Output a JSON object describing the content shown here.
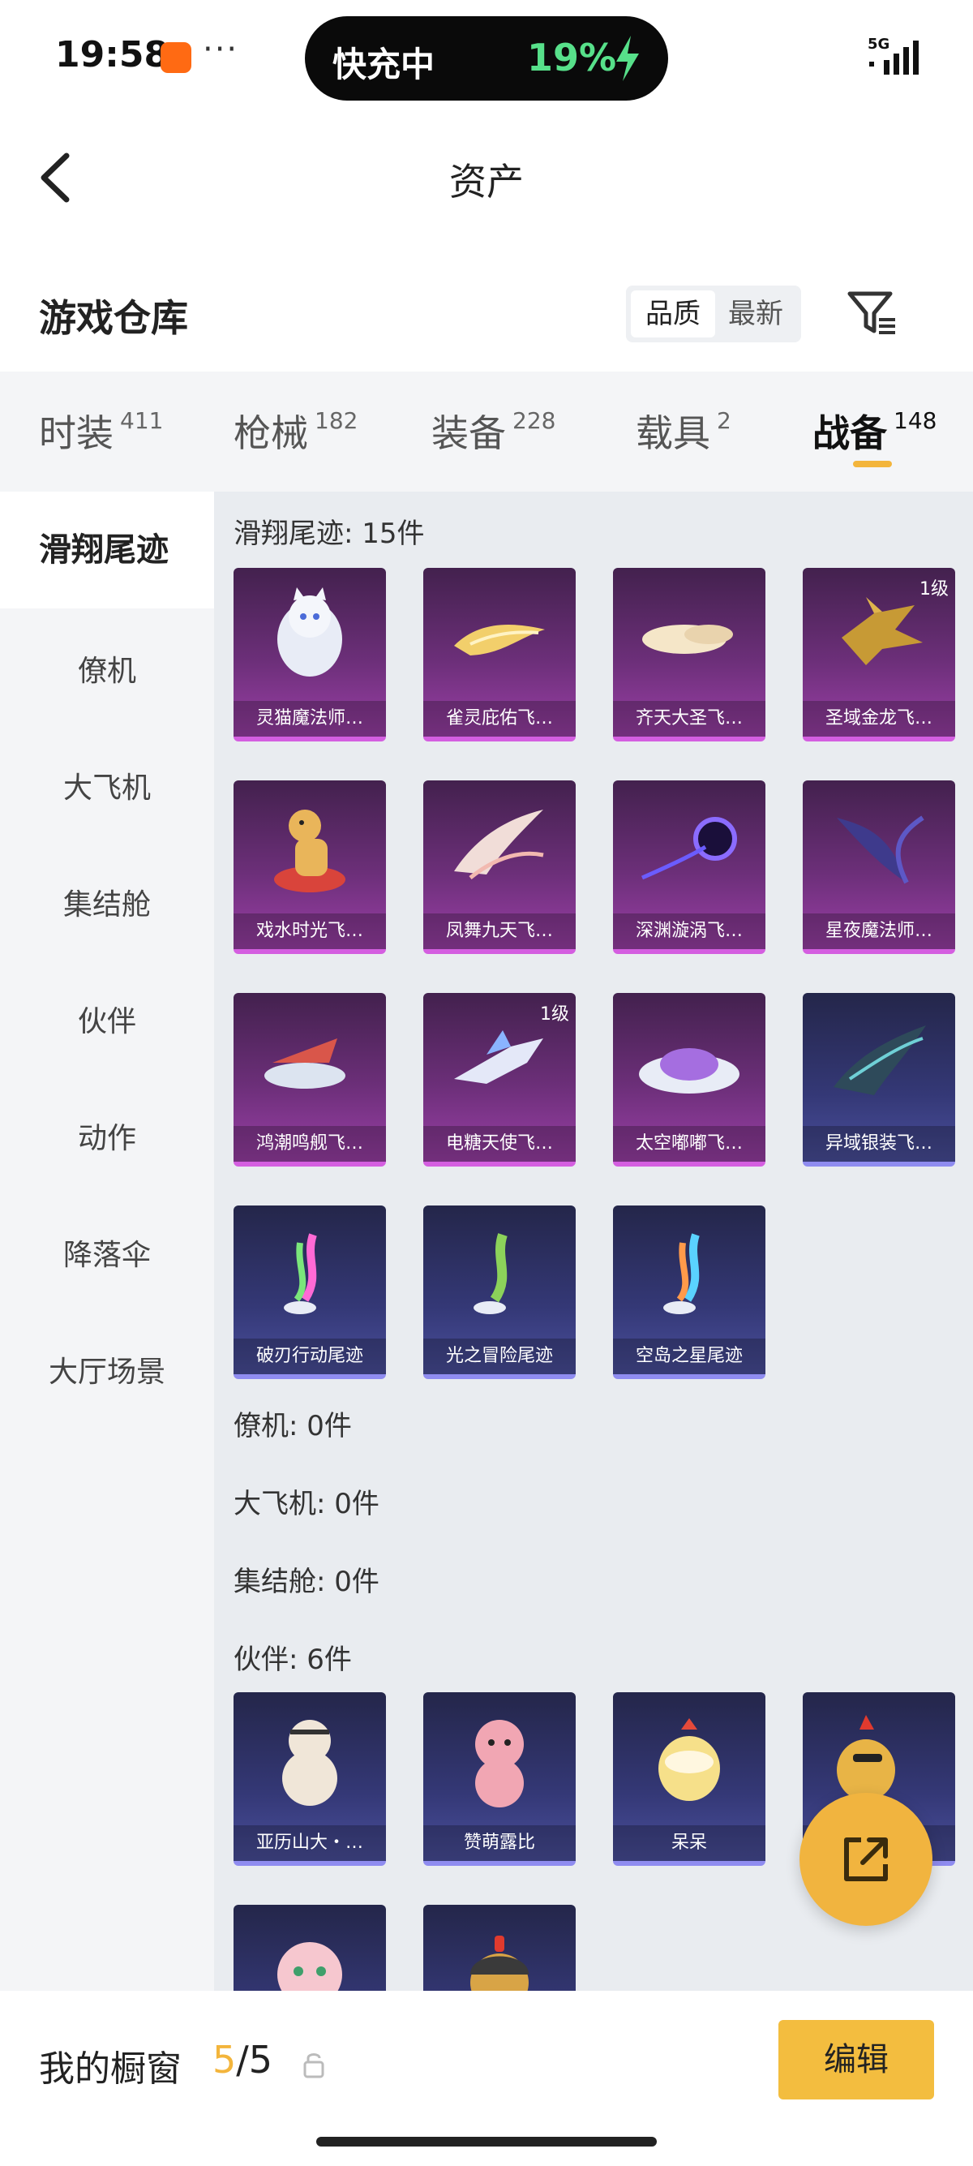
{
  "status_bar": {
    "time": "19:58",
    "app_icon_text": "",
    "menu_dots": "···",
    "charging_label": "快充中",
    "battery_percent": "19%",
    "network": "5G"
  },
  "header": {
    "title": "资产"
  },
  "warehouse": {
    "title": "游戏仓库",
    "sort_options": [
      "品质",
      "最新"
    ]
  },
  "tabs": [
    {
      "label": "时装",
      "count": "411"
    },
    {
      "label": "枪械",
      "count": "182"
    },
    {
      "label": "装备",
      "count": "228"
    },
    {
      "label": "载具",
      "count": "2"
    },
    {
      "label": "战备",
      "count": "148"
    }
  ],
  "sidebar": {
    "items": [
      "滑翔尾迹",
      "僚机",
      "大飞机",
      "集结舱",
      "伙伴",
      "动作",
      "降落伞",
      "大厅场景"
    ]
  },
  "groups": {
    "glide_trail": {
      "title": "滑翔尾迹: 15件",
      "items": [
        {
          "name": "灵猫魔法师…",
          "level": "",
          "rarity": "purple"
        },
        {
          "name": "雀灵庇佑飞…",
          "level": "",
          "rarity": "purple"
        },
        {
          "name": "齐天大圣飞…",
          "level": "",
          "rarity": "purple"
        },
        {
          "name": "圣域金龙飞…",
          "level": "1级",
          "rarity": "purple"
        },
        {
          "name": "戏水时光飞…",
          "level": "",
          "rarity": "purple"
        },
        {
          "name": "凤舞九天飞…",
          "level": "",
          "rarity": "purple"
        },
        {
          "name": "深渊漩涡飞…",
          "level": "",
          "rarity": "purple"
        },
        {
          "name": "星夜魔法师…",
          "level": "",
          "rarity": "purple"
        },
        {
          "name": "鸿潮鸣舰飞…",
          "level": "",
          "rarity": "purple"
        },
        {
          "name": "电糖天使飞…",
          "level": "1级",
          "rarity": "purple"
        },
        {
          "name": "太空嘟嘟飞…",
          "level": "",
          "rarity": "purple"
        },
        {
          "name": "异域银装飞…",
          "level": "",
          "rarity": "blue"
        },
        {
          "name": "破刃行动尾迹",
          "level": "",
          "rarity": "blue"
        },
        {
          "name": "光之冒险尾迹",
          "level": "",
          "rarity": "blue"
        },
        {
          "name": "空岛之星尾迹",
          "level": "",
          "rarity": "blue"
        }
      ]
    },
    "wingman": {
      "title": "僚机: 0件"
    },
    "big_plane": {
      "title": "大飞机: 0件"
    },
    "pod": {
      "title": "集结舱: 0件"
    },
    "partner": {
      "title": "伙伴: 6件",
      "items": [
        {
          "name": "亚历山大・…",
          "rarity": "blue"
        },
        {
          "name": "赞萌露比",
          "rarity": "blue"
        },
        {
          "name": "呆呆",
          "rarity": "blue"
        },
        {
          "name": "",
          "rarity": "blue"
        },
        {
          "name": "",
          "rarity": "blue"
        },
        {
          "name": "",
          "rarity": "blue"
        }
      ]
    }
  },
  "bottom_bar": {
    "showcase_label": "我的橱窗",
    "showcase_current": "5",
    "showcase_total": "/5",
    "edit_label": "编辑"
  },
  "colors": {
    "accent": "#f3b53c",
    "purple_rarity": "#d45ee0",
    "blue_rarity": "#8f8cf0"
  }
}
